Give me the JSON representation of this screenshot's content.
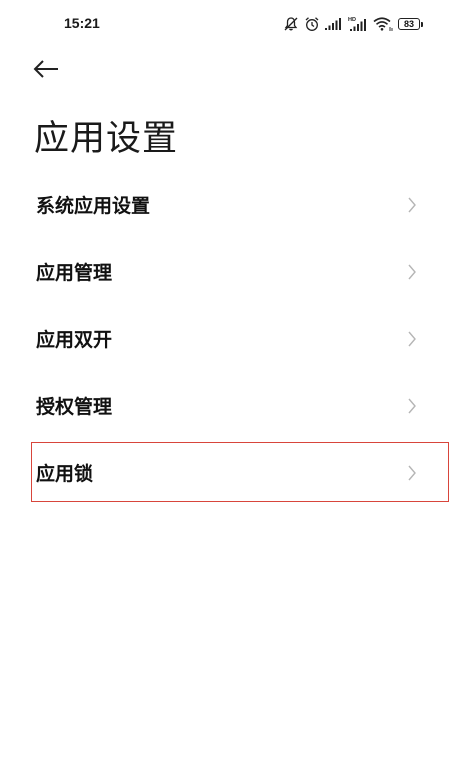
{
  "status_bar": {
    "time": "15:21",
    "battery": "83",
    "icons": [
      "mute-bell-icon",
      "alarm-icon",
      "signal-icon",
      "hd-signal-icon",
      "wifi-icon",
      "battery-icon"
    ]
  },
  "header": {
    "back_icon": "arrow-left-icon",
    "title": "应用设置"
  },
  "settings": {
    "items": [
      {
        "label": "系统应用设置"
      },
      {
        "label": "应用管理"
      },
      {
        "label": "应用双开"
      },
      {
        "label": "授权管理"
      },
      {
        "label": "应用锁"
      }
    ]
  },
  "colors": {
    "highlight": "#d8453b",
    "chevron": "#b5b5b5",
    "text": "#111111"
  }
}
